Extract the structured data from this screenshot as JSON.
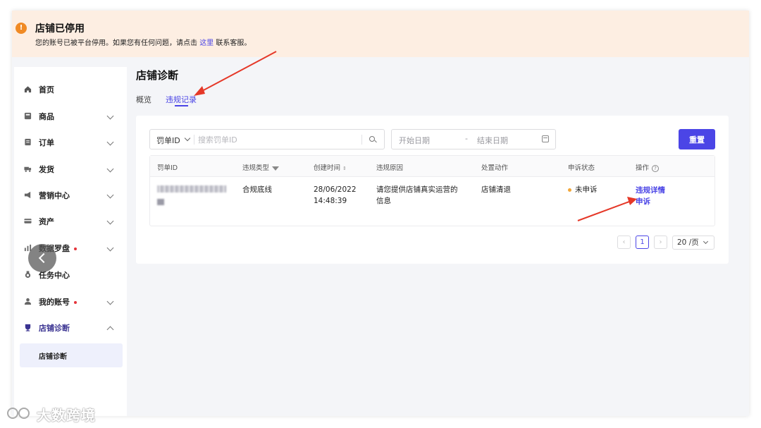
{
  "banner": {
    "icon": "!",
    "title": "店铺已停用",
    "message_pre": "您的账号已被平台停用。如果您有任何问题，请点击",
    "link": "这里",
    "message_post": "联系客服。"
  },
  "sidebar": {
    "items": [
      {
        "label": "首页",
        "icon": "home-icon",
        "has_chevron": false
      },
      {
        "label": "商品",
        "icon": "product-icon",
        "has_chevron": true
      },
      {
        "label": "订单",
        "icon": "order-icon",
        "has_chevron": true
      },
      {
        "label": "发货",
        "icon": "shipping-icon",
        "has_chevron": true
      },
      {
        "label": "营销中心",
        "icon": "marketing-icon",
        "has_chevron": true
      },
      {
        "label": "资产",
        "icon": "assets-icon",
        "has_chevron": true
      },
      {
        "label": "数据罗盘",
        "icon": "data-compass-icon",
        "has_chevron": true,
        "badge_dot": true
      },
      {
        "label": "任务中心",
        "icon": "task-icon",
        "has_chevron": false
      },
      {
        "label": "我的账号",
        "icon": "account-icon",
        "has_chevron": true,
        "badge_dot": true
      },
      {
        "label": "店铺诊断",
        "icon": "diagnosis-icon",
        "has_chevron": true,
        "expanded": true,
        "active": true
      }
    ],
    "sub_item": "店铺诊断"
  },
  "main": {
    "title": "店铺诊断",
    "tabs": [
      {
        "label": "概览",
        "active": false
      },
      {
        "label": "违规记录",
        "active": true
      }
    ],
    "filters": {
      "search_type": "罚单ID",
      "search_placeholder": "搜索罚单ID",
      "date_start_placeholder": "开始日期",
      "date_separator": "-",
      "date_end_placeholder": "结束日期",
      "reset_label": "重置"
    },
    "table": {
      "headers": [
        "罚单ID",
        "违规类型",
        "创建时间",
        "违规原因",
        "处置动作",
        "申诉状态",
        "操作"
      ],
      "rows": [
        {
          "violation_type": "合规底线",
          "created_date": "28/06/2022",
          "created_time": "14:48:39",
          "reason_line1": "请您提供店铺真实运营的",
          "reason_line2": "信息",
          "action": "店铺清退",
          "appeal_status": "未申诉",
          "op_details": "违规详情",
          "op_appeal": "申诉"
        }
      ]
    },
    "pagination": {
      "current_page": "1",
      "prev": "‹",
      "next": "›",
      "page_size": "20 /页"
    }
  },
  "colors": {
    "accent": "#4b45e6",
    "banner_bg": "#fdeee2",
    "banner_icon": "#f08a24",
    "status_pending": "#f2a73a",
    "annotation_arrow": "#e53828"
  },
  "watermark": "大数跨境"
}
